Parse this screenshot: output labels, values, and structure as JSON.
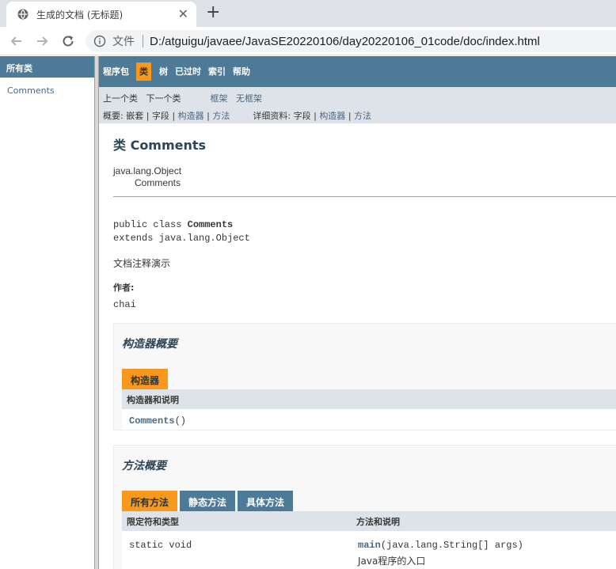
{
  "browser": {
    "tab_title": "生成的文档 (无标题)",
    "file_label": "文件",
    "url": "D:/atguigu/javaee/JavaSE20220106/day20220106_01code/doc/index.html"
  },
  "left_frame": {
    "header": "所有类",
    "classes": [
      "Comments"
    ]
  },
  "topnav": {
    "items": [
      "程序包",
      "类",
      "树",
      "已过时",
      "索引",
      "帮助"
    ]
  },
  "subnav": {
    "prev_class": "上一个类",
    "next_class": "下一个类",
    "frames": "框架",
    "no_frames": "无框架",
    "summary_label": "概要:",
    "summary_nested": "嵌套",
    "summary_field": "字段",
    "summary_constructor": "构造器",
    "summary_method": "方法",
    "detail_label": "详细资料:",
    "detail_field": "字段",
    "detail_constructor": "构造器",
    "detail_method": "方法",
    "pipe": "|"
  },
  "class_info": {
    "title": "类 Comments",
    "parent": "java.lang.Object",
    "child": "Comments",
    "sig_prefix": "public class ",
    "sig_name": "Comments",
    "sig_extends": "extends java.lang.Object",
    "description": "文档注释演示",
    "author_label": "作者:",
    "author": "chai"
  },
  "constructor_summary": {
    "title": "构造器概要",
    "tab": "构造器",
    "column": "构造器和说明",
    "constructor_name": "Comments",
    "constructor_args": "()"
  },
  "method_summary": {
    "title": "方法概要",
    "tabs": [
      "所有方法",
      "静态方法",
      "具体方法"
    ],
    "col_modifier": "限定符和类型",
    "col_method": "方法和说明",
    "modifier": "static void",
    "method_name": "main",
    "method_args": "(java.lang.String[]  args)",
    "method_desc": "Java程序的入口"
  },
  "colors": {
    "nav_blue": "#4d7a97",
    "active_orange": "#f8981d",
    "subnav_gray": "#dee3e9"
  }
}
